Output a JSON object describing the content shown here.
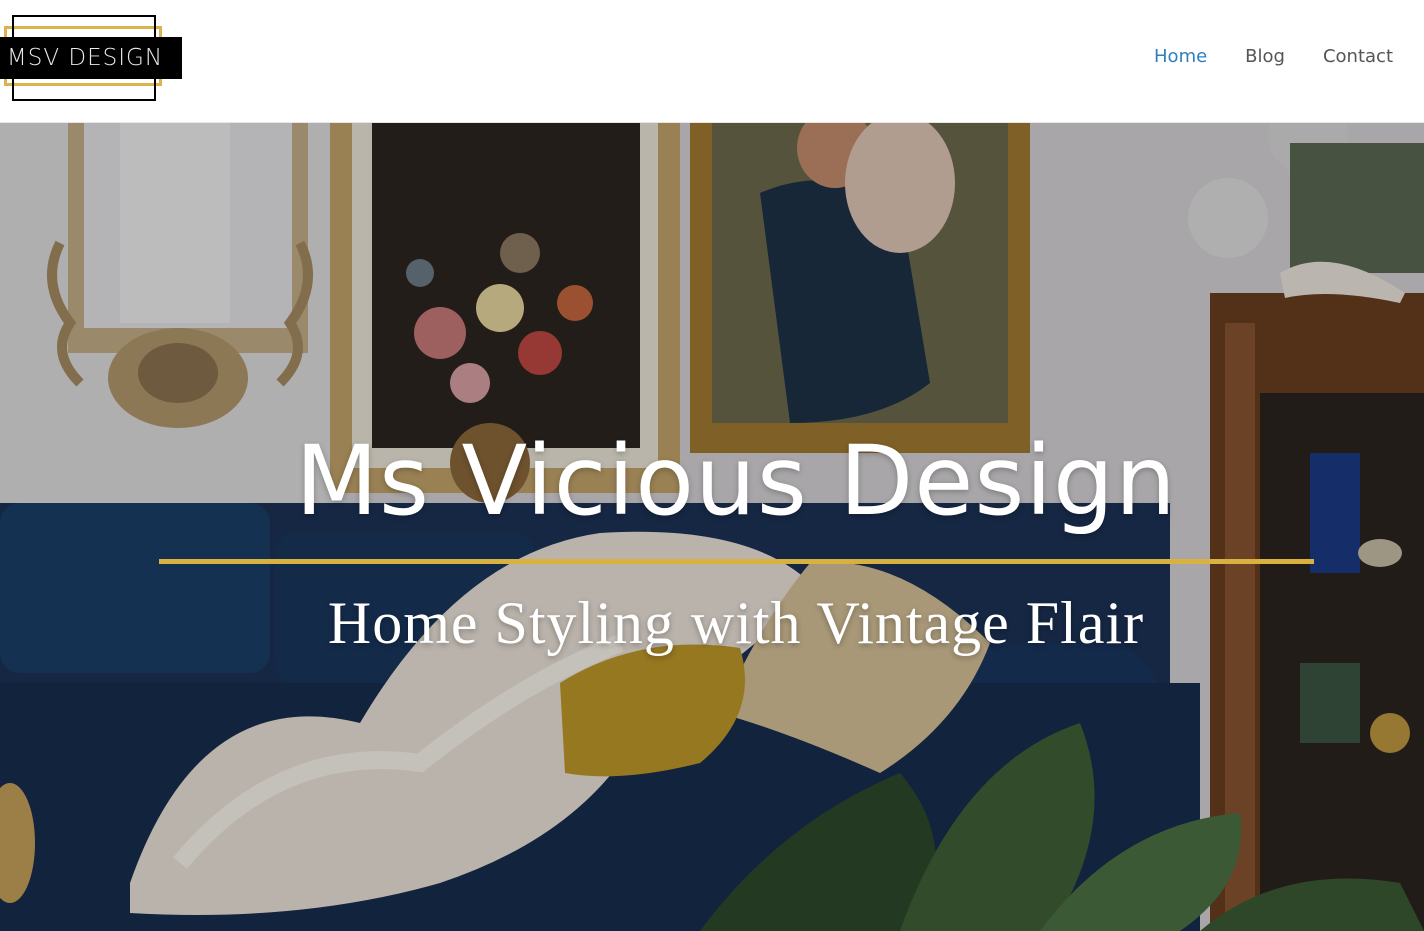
{
  "logo": {
    "text": "MSV DESIGN",
    "gold": "#d9b44a"
  },
  "nav": {
    "items": [
      {
        "label": "Home",
        "active": true
      },
      {
        "label": "Blog",
        "active": false
      },
      {
        "label": "Contact",
        "active": false
      }
    ],
    "active_color": "#2f7fbd",
    "text_color": "#555555"
  },
  "hero": {
    "title": "Ms Vicious Design",
    "subtitle": "Home Styling with Vintage Flair",
    "rule_color": "#d8b141"
  }
}
